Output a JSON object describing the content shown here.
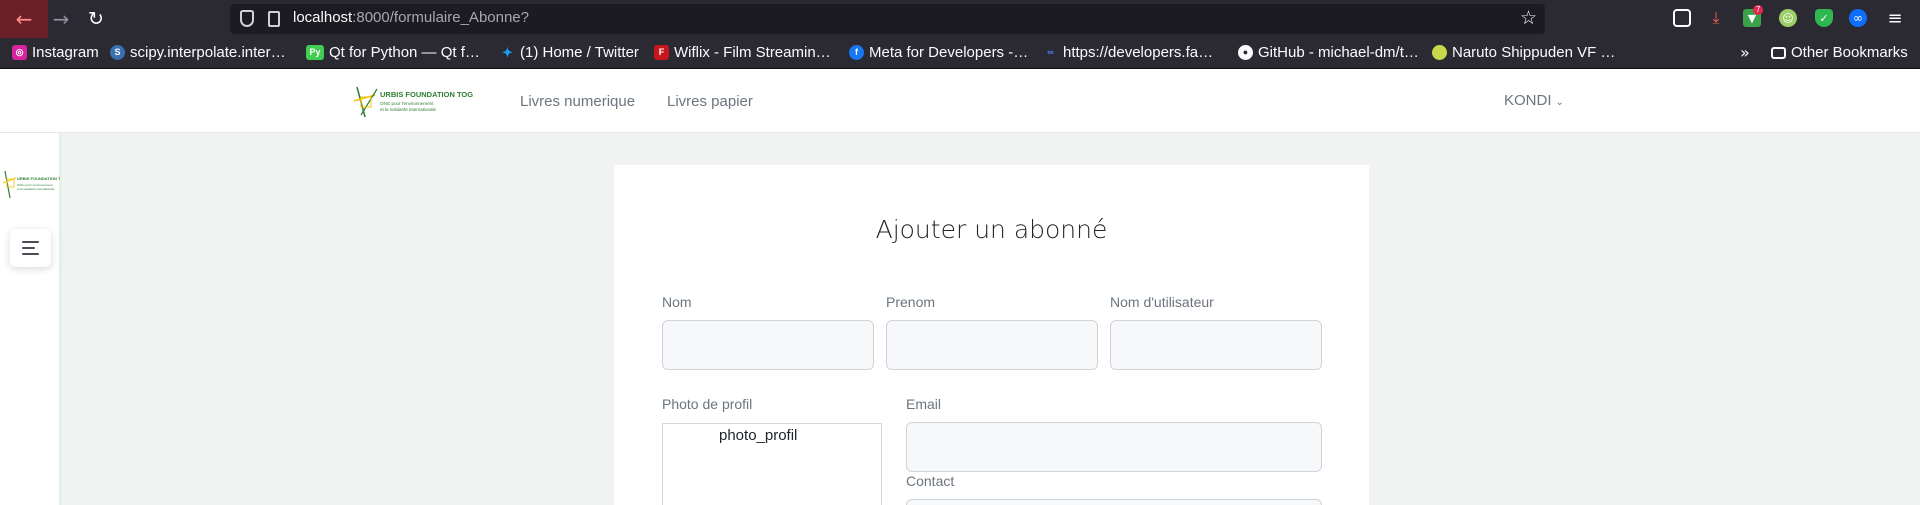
{
  "browser": {
    "url_host": "localhost",
    "url_path": ":8000/formulaire_Abonne?",
    "extension_badge": "7",
    "bookmarks": [
      "Instagram",
      "scipy.interpolate.inter…",
      "Qt for Python — Qt f…",
      "(1) Home / Twitter",
      "Wiflix - Film Streamin…",
      "Meta for Developers -…",
      "https://developers.fa…",
      "GitHub - michael-dm/t…",
      "Naruto Shippuden VF …"
    ],
    "other_bookmarks": "Other Bookmarks"
  },
  "header": {
    "logo_text": "URBIS FOUNDATION TOGO",
    "logo_sub": "ONG pour l'environnement et la solidarité internationale",
    "nav": [
      "Livres numerique",
      "Livres papier"
    ],
    "user": "KONDI"
  },
  "form": {
    "title": "Ajouter un abonné",
    "labels": {
      "nom": "Nom",
      "prenom": "Prenom",
      "username": "Nom d'utilisateur",
      "photo": "Photo de profil",
      "email": "Email",
      "contact": "Contact"
    },
    "photo_alt": "photo_profil"
  },
  "colors": {
    "brand_green": "#2e7d32",
    "brand_yellow": "#f5c400"
  }
}
